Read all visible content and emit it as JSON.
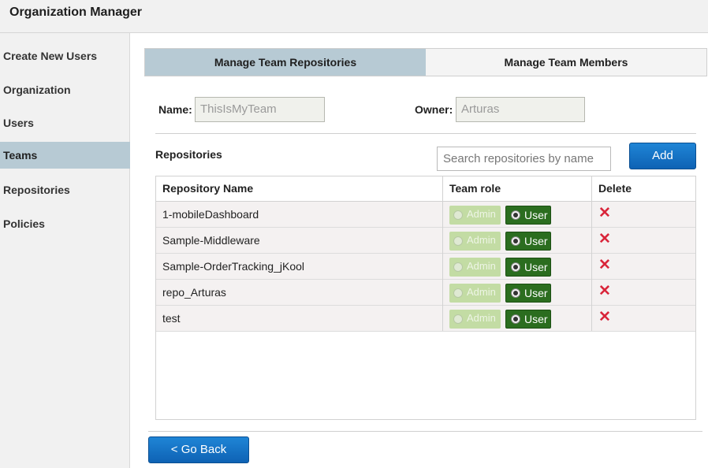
{
  "app": {
    "title": "Organization Manager"
  },
  "sidebar": {
    "items": [
      {
        "label": "Create New Users"
      },
      {
        "label": "Organization"
      },
      {
        "label": "Users"
      },
      {
        "label": "Teams",
        "active": true
      },
      {
        "label": "Repositories"
      },
      {
        "label": "Policies"
      }
    ]
  },
  "tabs": [
    {
      "label": "Manage Team Repositories",
      "active": true
    },
    {
      "label": "Manage Team Members"
    }
  ],
  "form": {
    "name_label": "Name:",
    "name_value": "ThisIsMyTeam",
    "owner_label": "Owner:",
    "owner_value": "Arturas"
  },
  "repositories": {
    "heading": "Repositories",
    "search_placeholder": "Search repositories by name",
    "add_label": "Add",
    "columns": [
      "Repository Name",
      "Team role",
      "Delete"
    ],
    "rows": [
      {
        "name": "1-mobileDashboard",
        "admin_label": "Admin",
        "user_label": "User",
        "role": "User"
      },
      {
        "name": "Sample-Middleware",
        "admin_label": "Admin",
        "user_label": "User",
        "role": "User"
      },
      {
        "name": "Sample-OrderTracking_jKool",
        "admin_label": "Admin",
        "user_label": "User",
        "role": "User"
      },
      {
        "name": "repo_Arturas",
        "admin_label": "Admin",
        "user_label": "User",
        "role": "User"
      },
      {
        "name": "test",
        "admin_label": "Admin",
        "user_label": "User",
        "role": "User"
      }
    ]
  },
  "footer": {
    "back_label": "< Go Back"
  },
  "colors": {
    "accent_blue": "#1a7acb",
    "user_green": "#2b6d1f",
    "admin_green": "#c3dca4",
    "delete_red": "#d9253a",
    "active_tab": "#b7cad4"
  },
  "icons": {
    "delete": "close-x-icon",
    "radio": "radio-icon"
  }
}
